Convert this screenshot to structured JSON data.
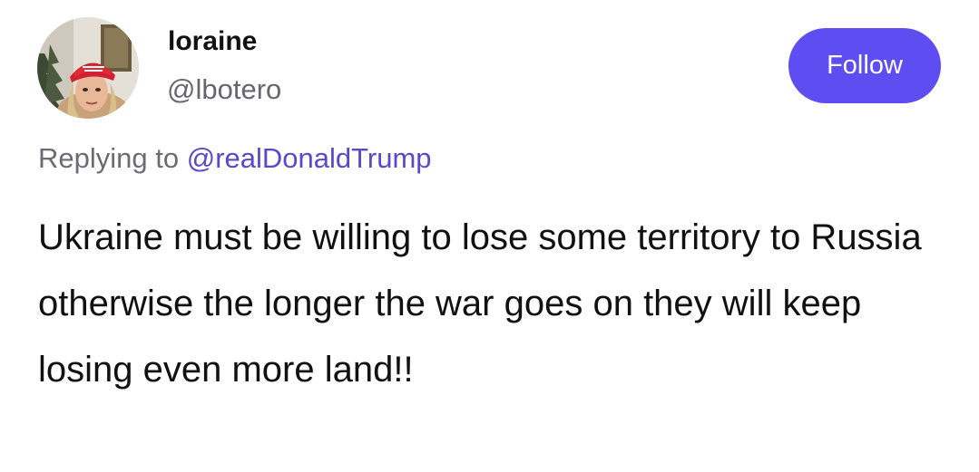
{
  "author": {
    "display_name": "loraine",
    "handle": "@lbotero",
    "avatar": "user-avatar-photo"
  },
  "follow_button": {
    "label": "Follow",
    "color": "#5e4df0"
  },
  "reply_context": {
    "prefix": "Replying to ",
    "mention": "@realDonaldTrump",
    "mention_color": "#5a48c8"
  },
  "post": {
    "text": "Ukraine must be willing to lose some territory to Russia otherwise the longer the war goes on they will keep losing even more land!!"
  }
}
